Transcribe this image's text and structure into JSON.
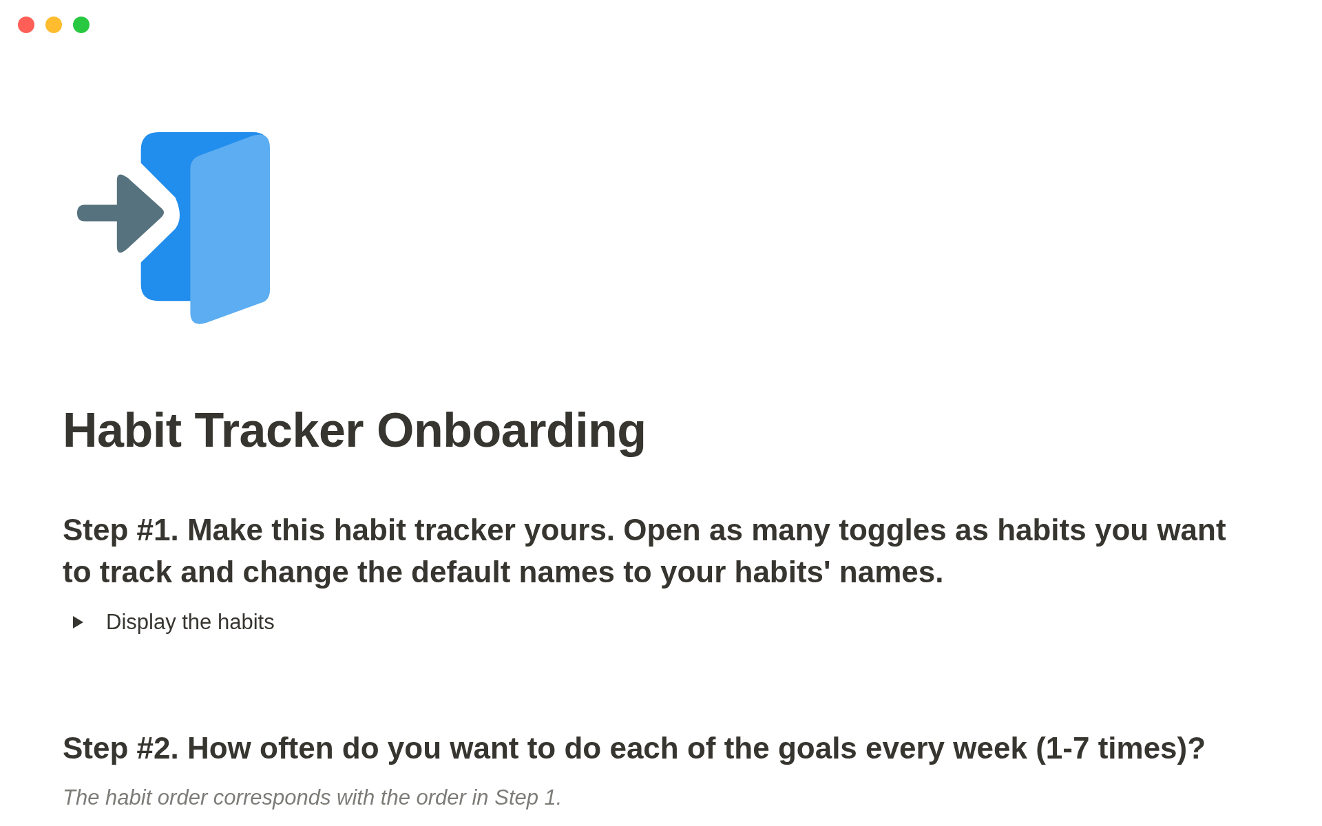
{
  "window": {
    "controls": [
      {
        "color": "#ff5f57"
      },
      {
        "color": "#febc2e"
      },
      {
        "color": "#28c840"
      }
    ]
  },
  "page": {
    "title": "Habit Tracker Onboarding",
    "blocks": [
      {
        "kind": "heading",
        "text": "Step #1. Make this habit tracker yours. Open as many toggles as habits you want to track and change the default names to your habits' names."
      },
      {
        "kind": "toggle",
        "text": "Display the habits",
        "expanded": false
      },
      {
        "kind": "heading",
        "text": "Step #2. How often do you want to do each of the goals every week (1-7 times)?"
      },
      {
        "kind": "note",
        "text": "The habit order corresponds with the order in Step 1."
      }
    ]
  }
}
